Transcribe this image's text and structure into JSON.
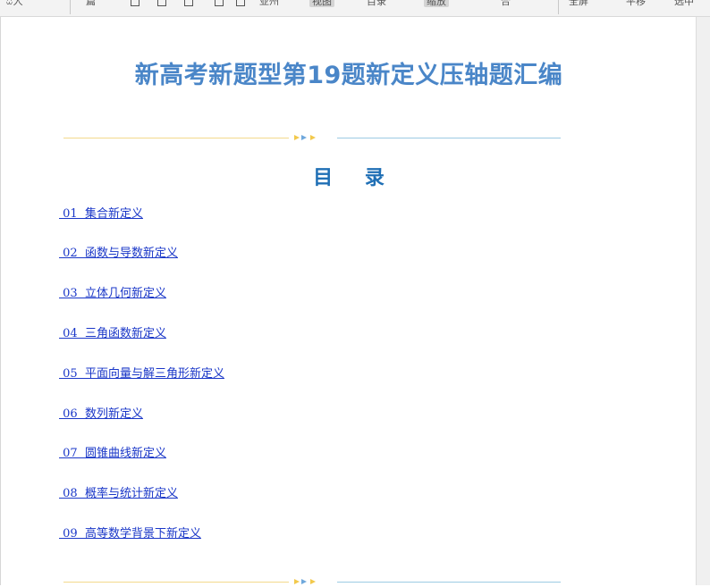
{
  "toolbar": {
    "items": [
      "ꀠ人",
      "篇",
      "亚州",
      "视图",
      "目录",
      "缩放",
      "合",
      "全屏",
      "平移",
      "选中",
      "横排",
      "竖排"
    ]
  },
  "document": {
    "title": "新高考新题型第19题新定义压轴题汇编",
    "toc_heading": "目 录",
    "toc": [
      {
        "label": " 01  集合新定义"
      },
      {
        "label": " 02  函数与导数新定义"
      },
      {
        "label": " 03  立体几何新定义"
      },
      {
        "label": " 04  三角函数新定义"
      },
      {
        "label": " 05  平面向量与解三角形新定义"
      },
      {
        "label": " 06  数列新定义"
      },
      {
        "label": " 07  圆锥曲线新定义"
      },
      {
        "label": " 08  概率与统计新定义"
      },
      {
        "label": " 09  高等数学背景下新定义"
      }
    ]
  },
  "colors": {
    "title": "#4a86c8",
    "toc_heading": "#1f6fb5",
    "link": "#1a37c8",
    "divider_gold": "#f3d98c",
    "divider_blue": "#9ccbe3"
  }
}
